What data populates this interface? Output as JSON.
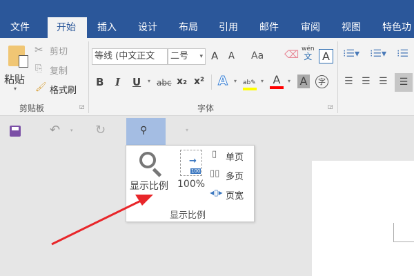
{
  "tabs": [
    "文件",
    "开始",
    "插入",
    "设计",
    "布局",
    "引用",
    "邮件",
    "审阅",
    "视图",
    "特色功"
  ],
  "active_tab": "开始",
  "clipboard": {
    "paste": "粘贴",
    "cut": "剪切",
    "copy": "复制",
    "format_painter": "格式刷",
    "group": "剪贴板"
  },
  "font": {
    "name": "等线 (中文正文",
    "size": "二号",
    "group": "字体",
    "bold": "B",
    "italic": "I",
    "underline": "U",
    "strike": "abc",
    "subscript": "x₂",
    "superscript": "x²",
    "grow": "A",
    "shrink": "A",
    "case": "Aa",
    "phonetic_top": "wén",
    "phonetic_bottom": "文",
    "border_char": "A",
    "highlight_color": "#ffff00",
    "font_color": "#ff0000",
    "circle_char": "字"
  },
  "zoom_popup": {
    "zoom": "显示比例",
    "hundred": "100%",
    "one_page": "单页",
    "multi_page": "多页",
    "page_width": "页宽",
    "group": "显示比例",
    "badge": "100"
  },
  "colors": {
    "title_bar": "#2b579a",
    "qat_selected": "#a4bde3",
    "arrow": "#e8262a"
  }
}
